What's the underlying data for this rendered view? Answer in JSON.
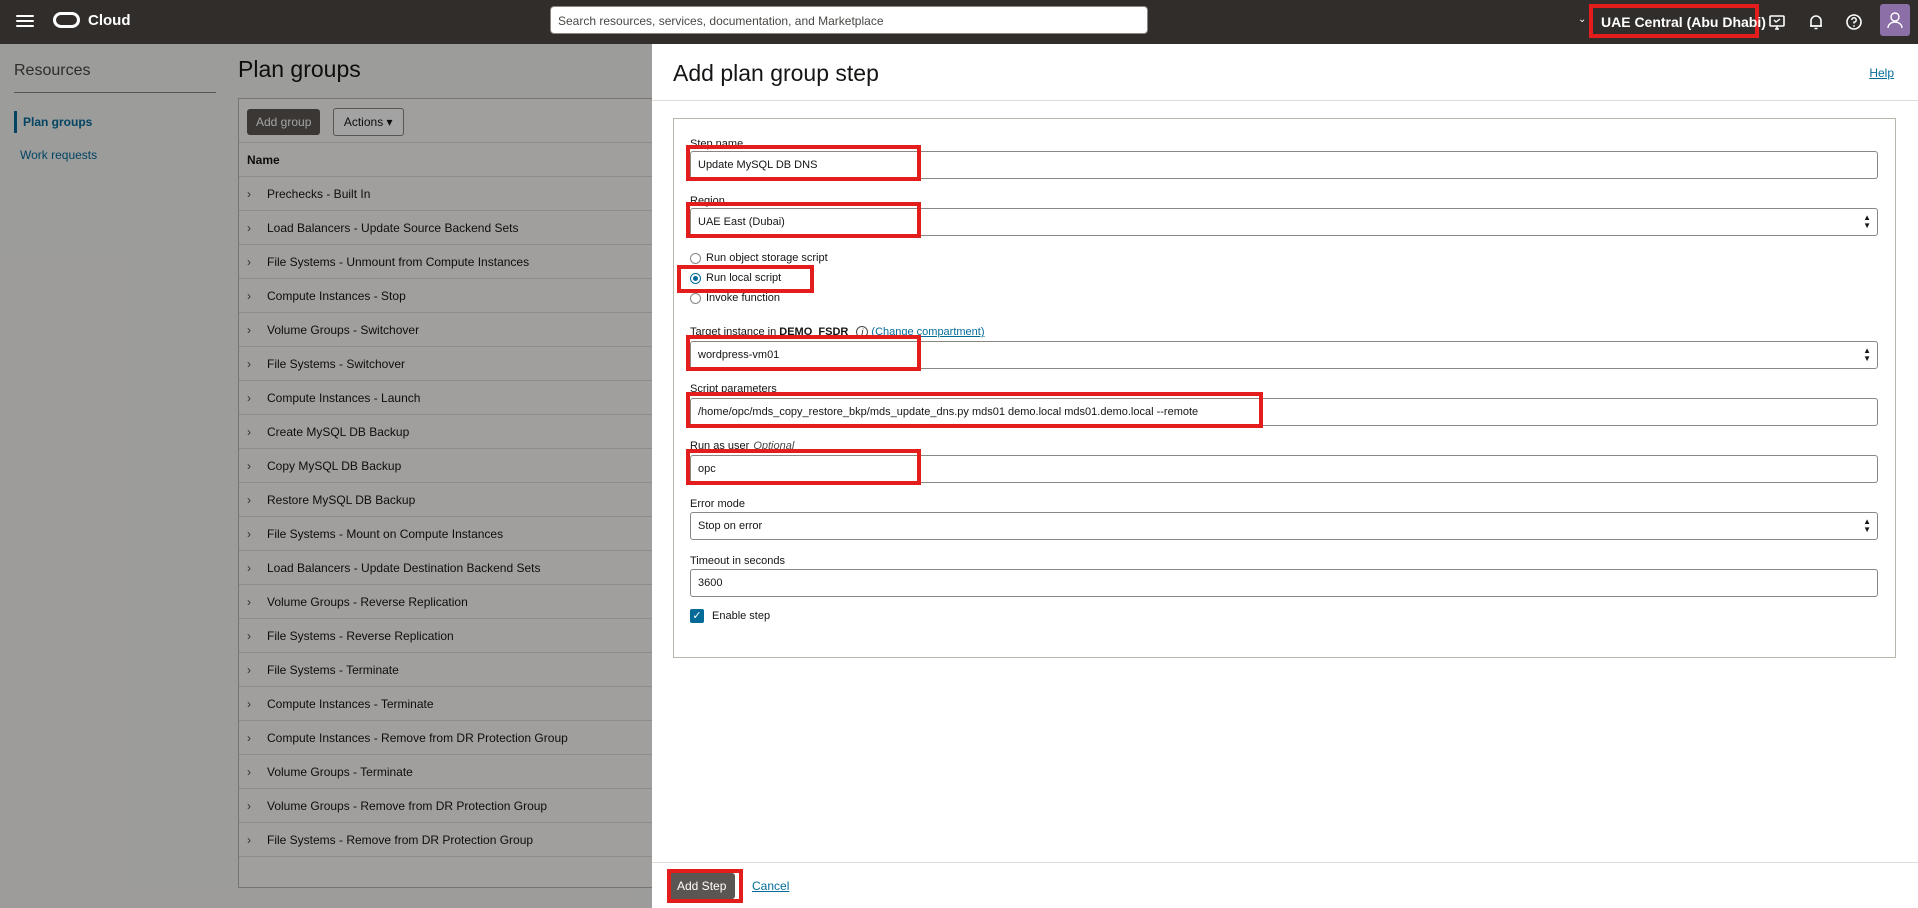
{
  "topbar": {
    "brand": "Cloud",
    "search_placeholder": "Search resources, services, documentation, and Marketplace",
    "region": "UAE Central (Abu Dhabi)"
  },
  "leftnav": {
    "title": "Resources",
    "items": [
      {
        "label": "Plan groups"
      },
      {
        "label": "Work requests"
      }
    ]
  },
  "page": {
    "title": "Plan groups",
    "add_group_label": "Add group",
    "actions_label": "Actions",
    "column_name": "Name",
    "rows": [
      "Prechecks - Built In",
      "Load Balancers - Update Source Backend Sets",
      "File Systems - Unmount from Compute Instances",
      "Compute Instances - Stop",
      "Volume Groups - Switchover",
      "File Systems - Switchover",
      "Compute Instances - Launch",
      "Create MySQL DB Backup",
      "Copy MySQL DB Backup",
      "Restore MySQL DB Backup",
      "File Systems - Mount on Compute Instances",
      "Load Balancers - Update Destination Backend Sets",
      "Volume Groups - Reverse Replication",
      "File Systems - Reverse Replication",
      "File Systems - Terminate",
      "Compute Instances - Terminate",
      "Compute Instances - Remove from DR Protection Group",
      "Volume Groups - Terminate",
      "Volume Groups - Remove from DR Protection Group",
      "File Systems - Remove from DR Protection Group"
    ]
  },
  "drawer": {
    "title": "Add plan group step",
    "help": "Help",
    "step_name_label": "Step name",
    "step_name_value": "Update MySQL DB DNS",
    "region_label": "Region",
    "region_value": "UAE East (Dubai)",
    "radio_options": [
      "Run object storage script",
      "Run local script",
      "Invoke function"
    ],
    "selected_radio": "Run local script",
    "target_label_prefix": "Target instance in",
    "target_compartment": "DEMO_FSDR",
    "change_compartment": "(Change compartment)",
    "target_value": "wordpress-vm01",
    "script_params_label": "Script parameters",
    "script_params_value": "/home/opc/mds_copy_restore_bkp/mds_update_dns.py mds01 demo.local mds01.demo.local --remote",
    "run_as_label": "Run as user",
    "run_as_optional": "Optional",
    "run_as_value": "opc",
    "error_mode_label": "Error mode",
    "error_mode_value": "Stop on error",
    "timeout_label": "Timeout in seconds",
    "timeout_value": "3600",
    "enable_step_label": "Enable step",
    "enable_step_checked": true,
    "add_step": "Add Step",
    "cancel": "Cancel"
  },
  "colors": {
    "topbar": "#312d2a",
    "highlight": "#e31c1c",
    "link": "#046b99",
    "primary_button": "#5b5652"
  }
}
